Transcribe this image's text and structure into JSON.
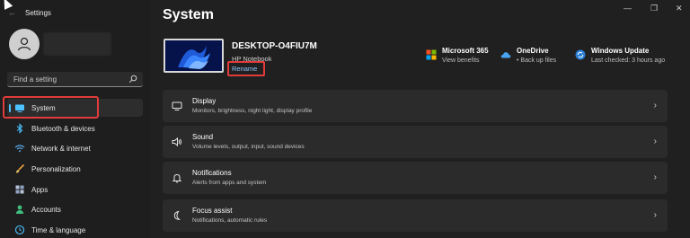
{
  "window": {
    "title": "Settings",
    "back_glyph": "←",
    "controls": {
      "minimize": "—",
      "maximize": "❐",
      "close": "✕"
    }
  },
  "sidebar": {
    "search": {
      "placeholder": "Find a setting"
    },
    "items": [
      {
        "label": "System",
        "icon": "monitor-icon",
        "active": true
      },
      {
        "label": "Bluetooth & devices",
        "icon": "bluetooth-icon"
      },
      {
        "label": "Network & internet",
        "icon": "wifi-icon"
      },
      {
        "label": "Personalization",
        "icon": "brush-icon"
      },
      {
        "label": "Apps",
        "icon": "apps-grid-icon"
      },
      {
        "label": "Accounts",
        "icon": "person-icon"
      },
      {
        "label": "Time & language",
        "icon": "globe-clock-icon"
      }
    ]
  },
  "main": {
    "title": "System",
    "device": {
      "name": "DESKTOP-O4FIU7M",
      "model": "HP Notebook",
      "rename": "Rename"
    },
    "quick_links": [
      {
        "title": "Microsoft 365",
        "subtitle": "View benefits",
        "icon": "microsoft-logo-icon"
      },
      {
        "title": "OneDrive",
        "subtitle": "• Back up files",
        "icon": "onedrive-cloud-icon"
      },
      {
        "title": "Windows Update",
        "subtitle": "Last checked: 3 hours ago",
        "icon": "windows-update-icon"
      }
    ],
    "cards": [
      {
        "title": "Display",
        "subtitle": "Monitors, brightness, night light, display profile",
        "icon": "display-icon"
      },
      {
        "title": "Sound",
        "subtitle": "Volume levels, output, input, sound devices",
        "icon": "speaker-icon"
      },
      {
        "title": "Notifications",
        "subtitle": "Alerts from apps and system",
        "icon": "bell-icon"
      },
      {
        "title": "Focus assist",
        "subtitle": "Notifications, automatic rules",
        "icon": "moon-icon"
      }
    ]
  },
  "colors": {
    "accent": "#4cc2ff",
    "highlight": "#e23b3b",
    "link": "#8fc6ff"
  }
}
